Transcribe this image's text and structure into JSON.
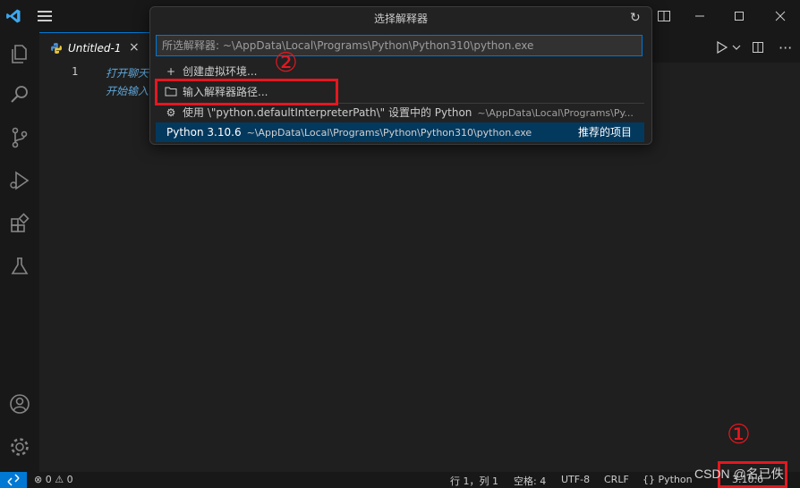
{
  "window": {
    "minimize_icon": "minimize-icon",
    "maximize_icon": "maximize-icon",
    "close_icon": "close-icon",
    "layout_icon": "layout-icon"
  },
  "tab": {
    "label": "Untitled-1",
    "close": "×"
  },
  "editor": {
    "line_number": "1",
    "lines": [
      "打开聊天",
      "开始输入"
    ]
  },
  "quick_pick": {
    "title": "选择解释器",
    "placeholder": "所选解释器: ~\\AppData\\Local\\Programs\\Python\\Python310\\python.exe",
    "items": [
      {
        "icon": "+",
        "label": "创建虚拟环境..."
      },
      {
        "icon": "folder-icon",
        "label": "输入解释器路径..."
      },
      {
        "icon": "gear-icon",
        "label": "使用 \\\"python.defaultInterpreterPath\\\" 设置中的 Python",
        "description": "~\\AppData\\Local\\Programs\\Py..."
      },
      {
        "label": "Python 3.10.6",
        "description": "~\\AppData\\Local\\Programs\\Python\\Python310\\python.exe",
        "badge": "推荐的项目"
      }
    ]
  },
  "status": {
    "errors": "0",
    "warnings": "0",
    "position": "行 1，列 1",
    "spaces": "空格: 4",
    "encoding": "UTF-8",
    "eol": "CRLF",
    "language": "Python",
    "interpreter": "3.10.6"
  },
  "annotations": {
    "one": "①",
    "two": "②"
  },
  "watermark": "CSDN @名已佚",
  "colors": {
    "accent": "#0078d4",
    "highlight": "#e5171f",
    "selected": "#04395e"
  }
}
